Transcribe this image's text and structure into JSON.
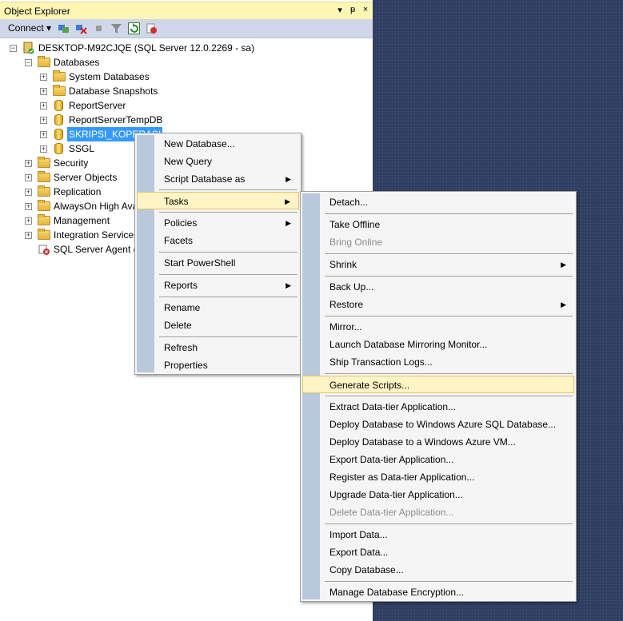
{
  "panel": {
    "title": "Object Explorer",
    "title_buttons": [
      "▾",
      "ᵽ",
      "×"
    ],
    "toolbar": {
      "connect_label": "Connect ▾"
    }
  },
  "tree": {
    "server": "DESKTOP-M92CJQE (SQL Server 12.0.2269 - sa)",
    "databases": "Databases",
    "system_databases": "System Databases",
    "database_snapshots": "Database Snapshots",
    "report_server": "ReportServer",
    "report_server_temp": "ReportServerTempDB",
    "selected_db": "SKRIPSI_KOPERASI",
    "ssgl": "SSGL",
    "security": "Security",
    "server_objects": "Server Objects",
    "replication": "Replication",
    "alwayson": "AlwaysOn High Ava",
    "management": "Management",
    "integration_services": "Integration Services",
    "sql_agent": "SQL Server Agent (A"
  },
  "context_menu": {
    "new_database": "New Database...",
    "new_query": "New Query",
    "script_database_as": "Script Database as",
    "tasks": "Tasks",
    "policies": "Policies",
    "facets": "Facets",
    "start_powershell": "Start PowerShell",
    "reports": "Reports",
    "rename": "Rename",
    "delete": "Delete",
    "refresh": "Refresh",
    "properties": "Properties"
  },
  "tasks_menu": {
    "detach": "Detach...",
    "take_offline": "Take Offline",
    "bring_online": "Bring Online",
    "shrink": "Shrink",
    "back_up": "Back Up...",
    "restore": "Restore",
    "mirror": "Mirror...",
    "launch_mirroring_monitor": "Launch Database Mirroring Monitor...",
    "ship_transaction_logs": "Ship Transaction Logs...",
    "generate_scripts": "Generate Scripts...",
    "extract_data_tier": "Extract Data-tier Application...",
    "deploy_azure_sql": "Deploy Database to Windows Azure SQL Database...",
    "deploy_azure_vm": "Deploy Database to a Windows Azure VM...",
    "export_data_tier": "Export Data-tier Application...",
    "register_data_tier": "Register as Data-tier Application...",
    "upgrade_data_tier": "Upgrade Data-tier Application...",
    "delete_data_tier": "Delete Data-tier Application...",
    "import_data": "Import Data...",
    "export_data": "Export Data...",
    "copy_database": "Copy Database...",
    "manage_encryption": "Manage Database Encryption..."
  },
  "colors": {
    "selection": "#3399ff",
    "menu_highlight": "#fff4c5",
    "title_bar": "#fff6b5",
    "gutter": "#b9c9dc"
  }
}
